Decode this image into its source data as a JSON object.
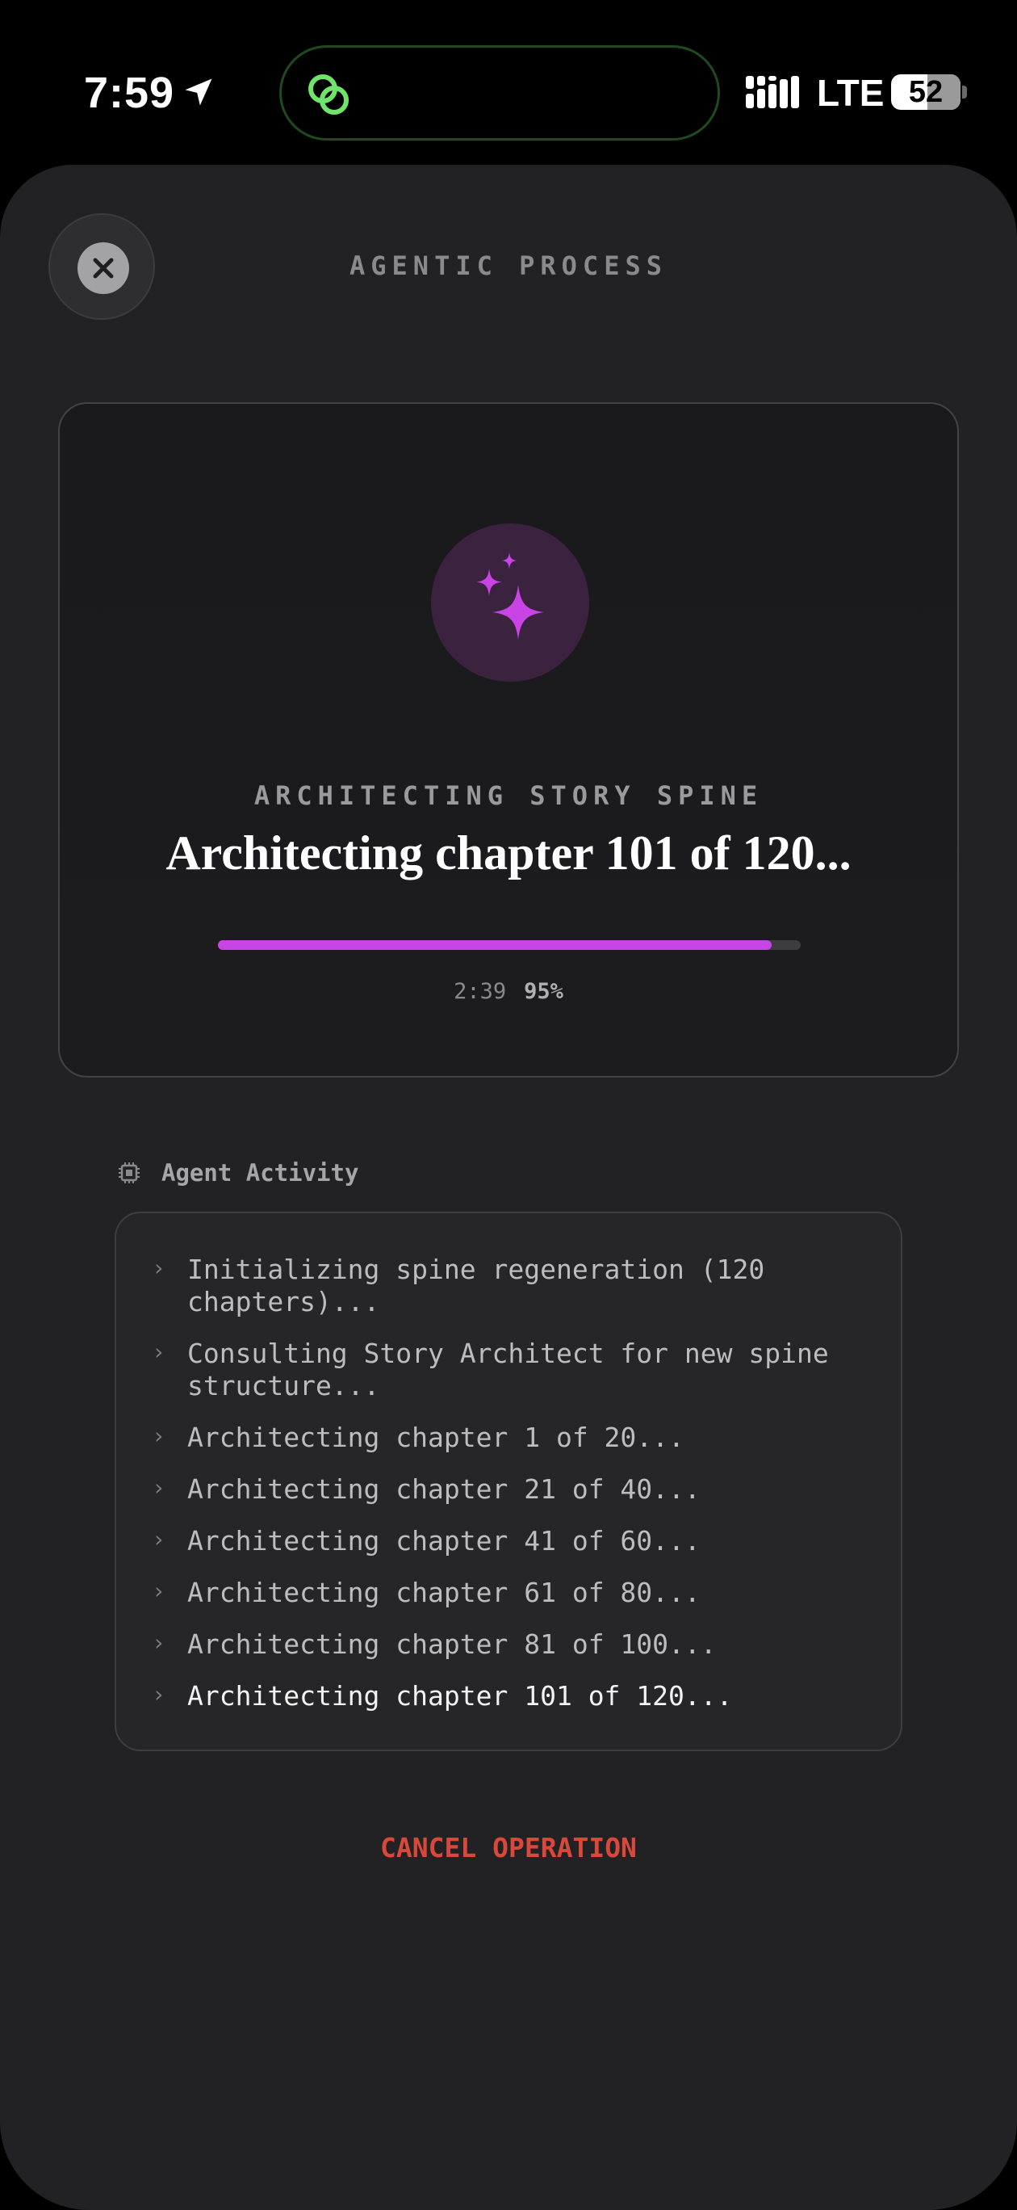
{
  "status_bar": {
    "time": "7:59",
    "network": "LTE",
    "battery": "52",
    "battery_level": 0.52,
    "location_icon": "location-arrow-icon",
    "island_icon": "link-app-icon",
    "accent_green": "#6fe36a"
  },
  "sheet": {
    "title": "AGENTIC PROCESS",
    "close_icon": "close-icon"
  },
  "progress": {
    "stage_label": "ARCHITECTING STORY SPINE",
    "heading": "Architecting chapter 101 of 120...",
    "elapsed": "2:39",
    "percent_text": "95%",
    "percent_value": 95,
    "accent": "#c844e4",
    "icon": "sparkles-icon"
  },
  "activity": {
    "title": "Agent Activity",
    "icon": "chip-icon",
    "items": [
      "Initializing spine regeneration (120 chapters)...",
      "Consulting Story Architect for new spine structure...",
      "Architecting chapter 1 of 20...",
      "Architecting chapter 21 of 40...",
      "Architecting chapter 41 of 60...",
      "Architecting chapter 61 of 80...",
      "Architecting chapter 81 of 100...",
      "Architecting chapter 101 of 120..."
    ]
  },
  "actions": {
    "cancel_label": "CANCEL OPERATION",
    "cancel_color": "#d9483b"
  }
}
